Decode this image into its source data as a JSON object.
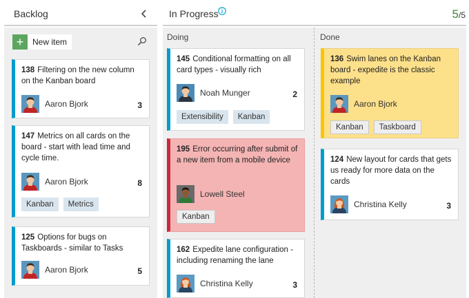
{
  "backlog": {
    "title": "Backlog",
    "new_item_label": "New item",
    "cards": [
      {
        "id": "138",
        "title": "Filtering on the new column on the Kanban board",
        "assignee": "Aaron Bjork",
        "estimate": "3",
        "tags": []
      },
      {
        "id": "147",
        "title": "Metrics on all cards on the board - start with lead time and cycle time.",
        "assignee": "Aaron Bjork",
        "estimate": "8",
        "tags": [
          "Kanban",
          "Metrics"
        ]
      },
      {
        "id": "125",
        "title": "Options for bugs on Taskboards - similar to Tasks",
        "assignee": "Aaron Bjork",
        "estimate": "5",
        "tags": []
      }
    ]
  },
  "in_progress": {
    "title": "In Progress",
    "wip_count": "5",
    "wip_limit": "/5",
    "doing": {
      "title": "Doing",
      "cards": [
        {
          "id": "145",
          "title": "Conditional formatting on all card types - visually rich",
          "assignee": "Noah Munger",
          "estimate": "2",
          "tags": [
            "Extensibility",
            "Kanban"
          ]
        },
        {
          "id": "195",
          "title": "Error occurring after submit of a new item from a mobile device",
          "assignee": "Lowell Steel",
          "estimate": "",
          "tags": [
            "Kanban"
          ]
        },
        {
          "id": "162",
          "title": "Expedite lane configuration - including renaming the lane",
          "assignee": "Christina Kelly",
          "estimate": "3",
          "tags": []
        }
      ]
    },
    "done": {
      "title": "Done",
      "cards": [
        {
          "id": "136",
          "title": "Swim lanes on the Kanban board - expedite is the classic example",
          "assignee": "Aaron Bjork",
          "estimate": "",
          "tags": [
            "Kanban",
            "Taskboard"
          ]
        },
        {
          "id": "124",
          "title": "New layout for cards that gets us ready for more data on the cards",
          "assignee": "Christina Kelly",
          "estimate": "3",
          "tags": []
        }
      ]
    }
  },
  "colors": {
    "accent_blue": "#009ccc",
    "bug_red": "#cc293d",
    "expedite_yellow": "#fbc500",
    "wip_green": "#3a8a2a"
  },
  "icons": {
    "collapse": "chevron-left-icon",
    "info": "info-icon",
    "add": "plus-icon",
    "search": "search-icon"
  }
}
